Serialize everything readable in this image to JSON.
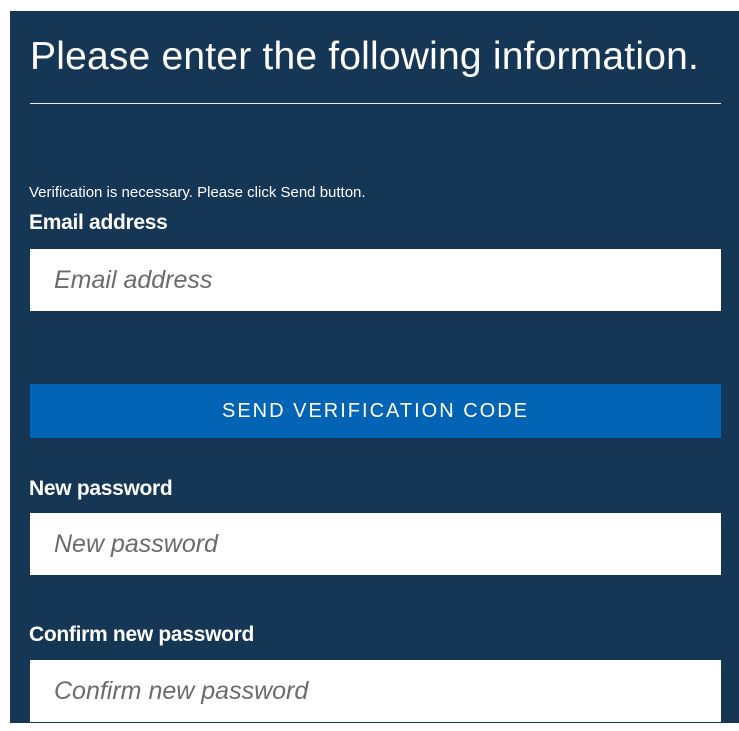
{
  "form": {
    "heading": "Please enter the following information.",
    "intro_text": "Verification is necessary. Please click Send button.",
    "email": {
      "label": "Email address",
      "placeholder": "Email address",
      "value": ""
    },
    "send_button_label": "SEND VERIFICATION CODE",
    "new_password": {
      "label": "New password",
      "placeholder": "New password",
      "value": ""
    },
    "confirm_password": {
      "label": "Confirm new password",
      "placeholder": "Confirm new password",
      "value": ""
    }
  },
  "colors": {
    "panel_background": "#163656",
    "button_background": "#0363b4",
    "text": "#ffffff",
    "input_background": "#ffffff"
  }
}
